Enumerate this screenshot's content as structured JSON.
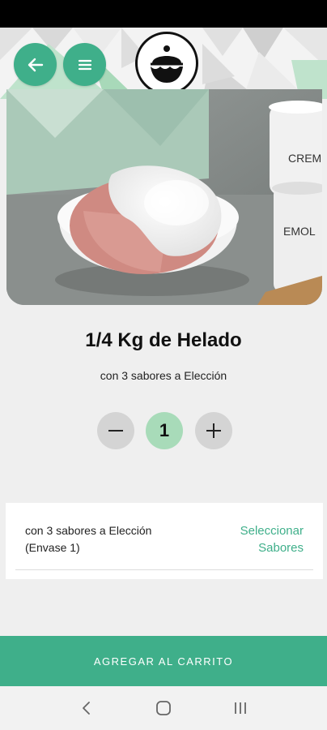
{
  "header": {
    "back_icon": "arrow-left-icon",
    "menu_icon": "hamburger-menu-icon",
    "logo_icon": "ice-cream-cup-logo",
    "accent_color": "#3faf8a"
  },
  "product": {
    "title": "1/4 Kg de Helado",
    "subtitle": "con 3 sabores a Elección",
    "image": "ice-cream-cup-photo"
  },
  "quantity": {
    "value": "1",
    "minus_icon": "minus-icon",
    "plus_icon": "plus-icon"
  },
  "option": {
    "line1": "con 3 sabores a Elección",
    "line2": "(Envase 1)",
    "link_line1": "Seleccionar",
    "link_line2": "Sabores"
  },
  "cart_button": {
    "label": "AGREGAR AL CARRITO"
  },
  "navbar": {
    "icons": [
      "back-nav-icon",
      "home-nav-icon",
      "recents-nav-icon"
    ]
  }
}
